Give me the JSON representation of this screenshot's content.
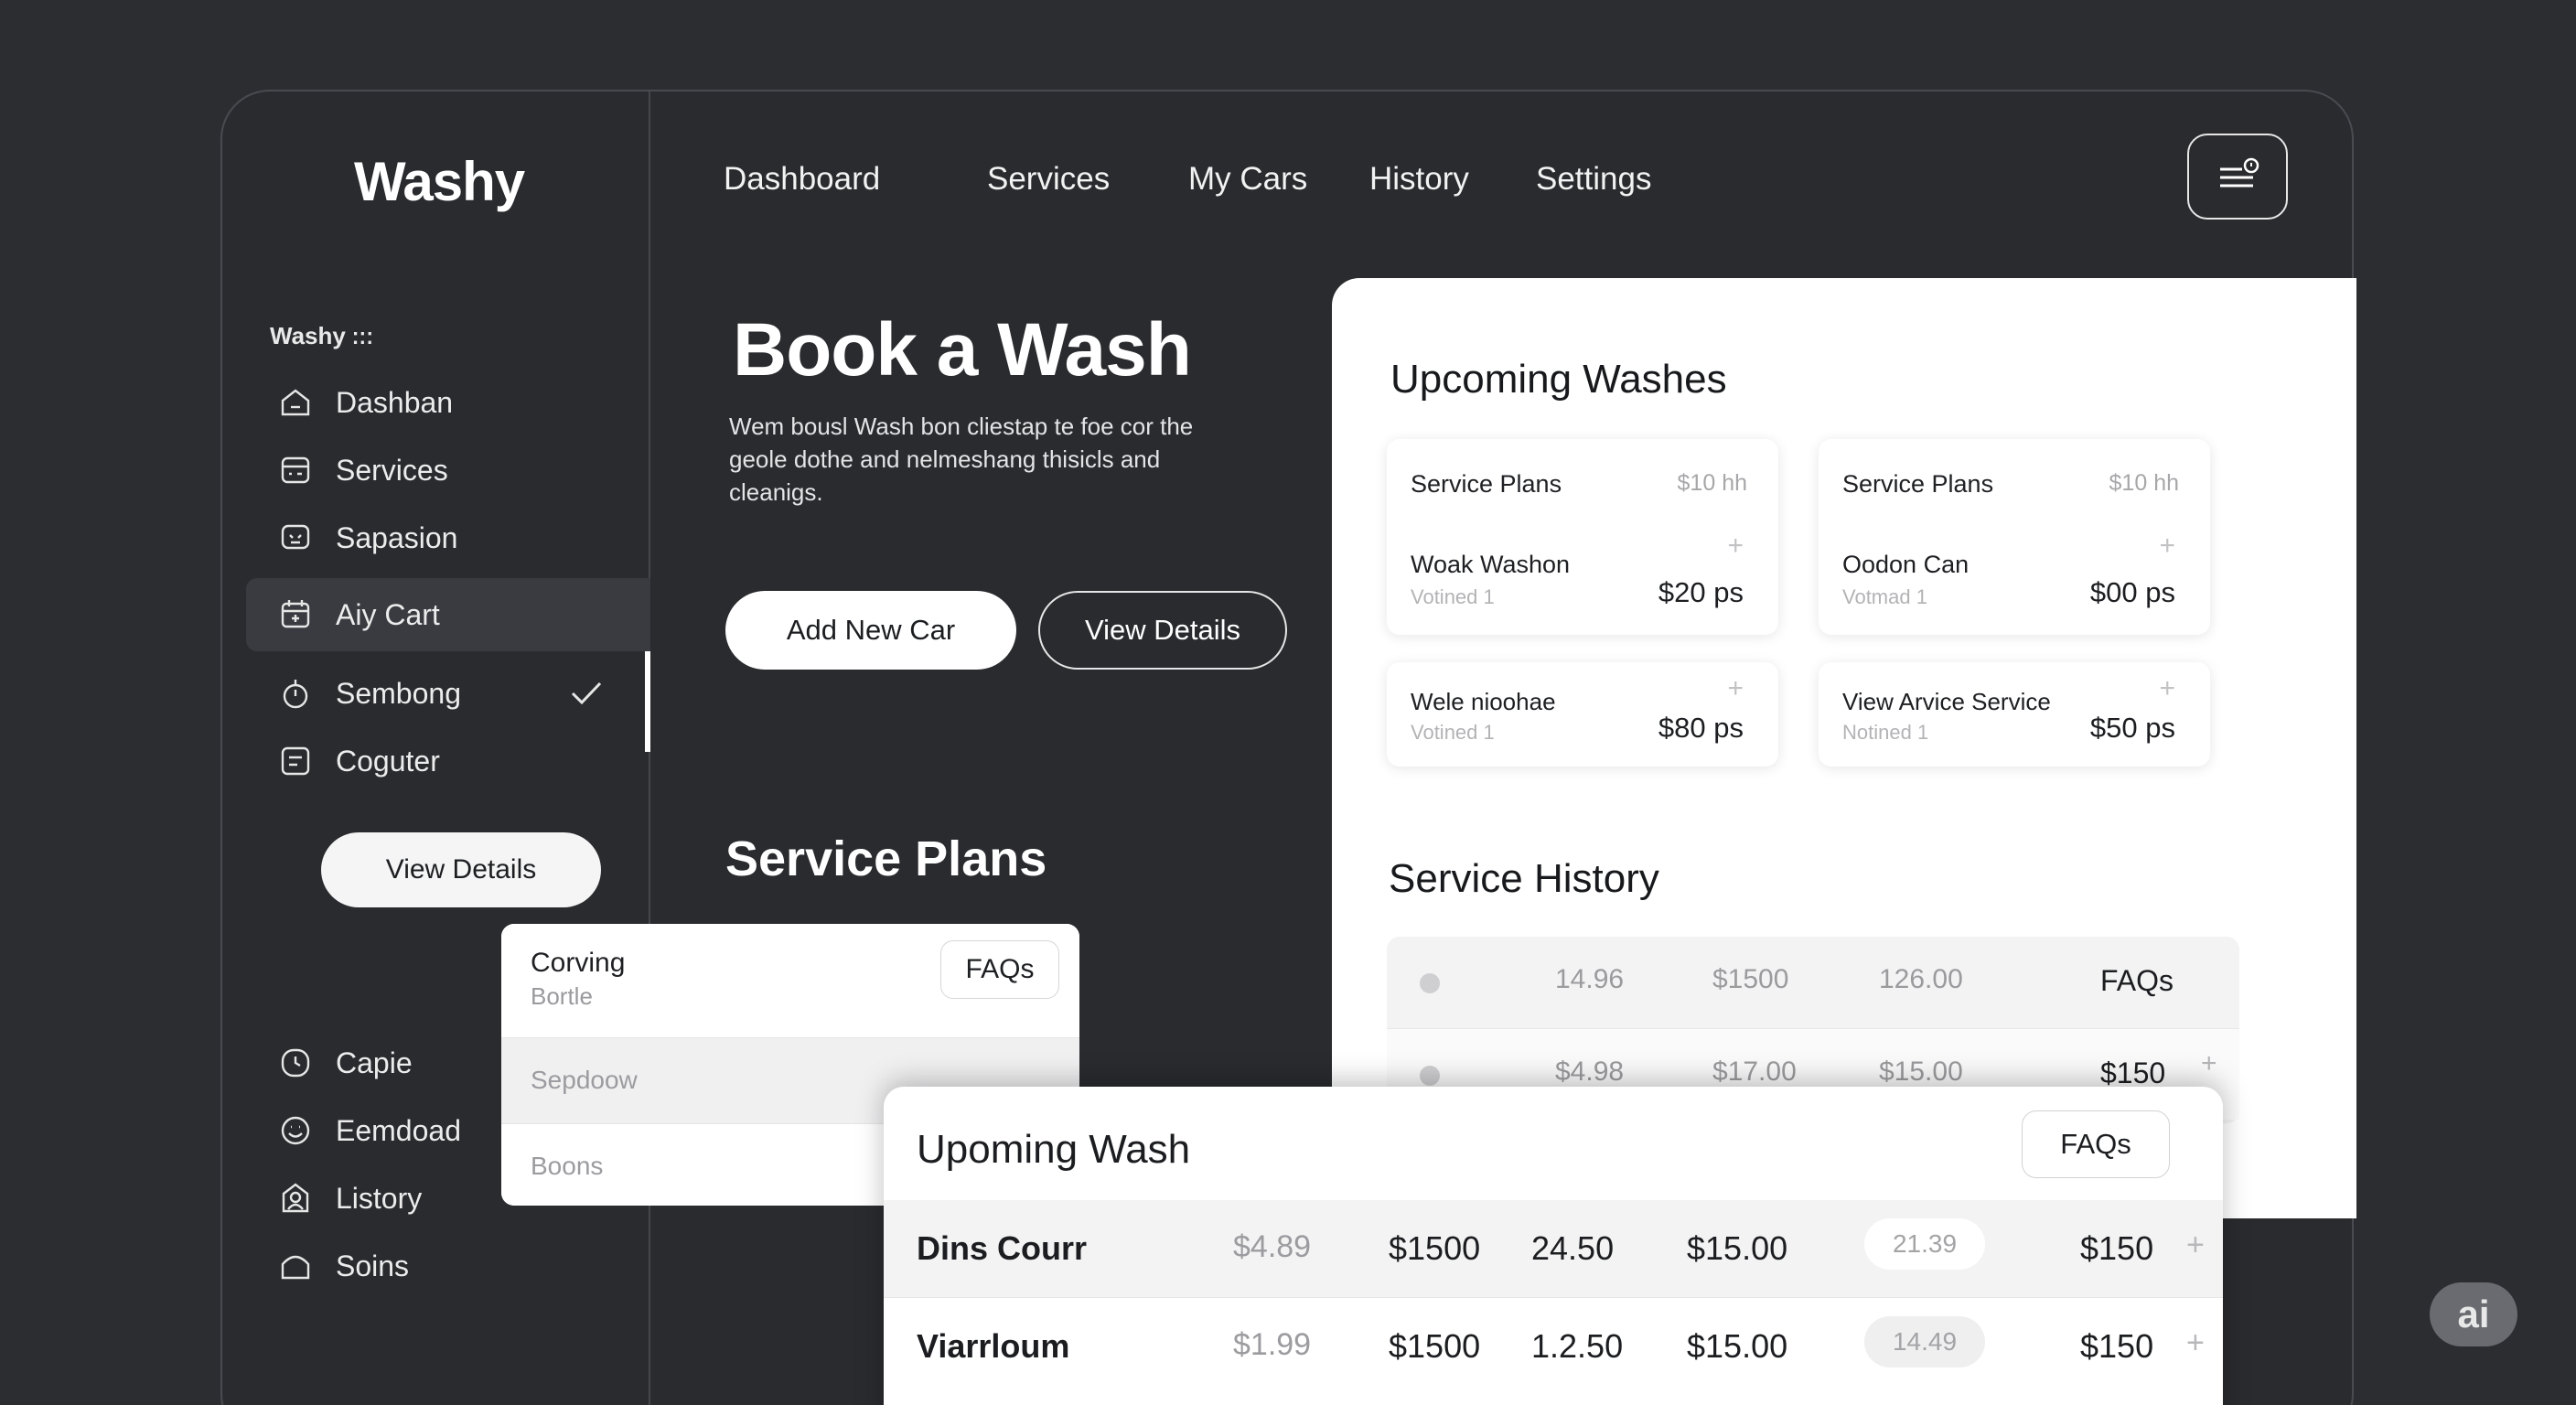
{
  "app": {
    "logo": "Washy"
  },
  "sidebar": {
    "section_label": "Washy",
    "items": [
      {
        "label": "Dashban",
        "icon": "home-icon"
      },
      {
        "label": "Services",
        "icon": "calendar-icon"
      },
      {
        "label": "Sapasion",
        "icon": "chat-icon"
      },
      {
        "label": "Aiy Cart",
        "icon": "calendar-plus-icon"
      },
      {
        "label": "Sembong",
        "icon": "timer-icon"
      },
      {
        "label": "Coguter",
        "icon": "list-icon"
      },
      {
        "label": "Capie",
        "icon": "clock-icon"
      },
      {
        "label": "Eemdoad",
        "icon": "smile-icon"
      },
      {
        "label": "Listory",
        "icon": "user-icon"
      },
      {
        "label": "Soins",
        "icon": "home-outline-icon"
      }
    ],
    "view_details": "View Details"
  },
  "nav": {
    "dashboard": "Dashboard",
    "services": "Services",
    "my_cars": "My Cars",
    "history": "History",
    "settings": "Settings"
  },
  "hero": {
    "title": "Book a Wash",
    "text": "Wem bousl Wash bon cliestap te foe cor the geole dothe and nelmeshang thisicls and cleanigs.",
    "add_button": "Add New Car",
    "view_button": "View Details"
  },
  "plans": {
    "title": "Service Plans",
    "faq": "FAQs",
    "rows": [
      {
        "title": "Corving",
        "sub": "Bortle"
      },
      {
        "title": "Sepdoow"
      },
      {
        "title": "Boons"
      }
    ]
  },
  "upcoming": {
    "title": "Upcoming Washes",
    "cards": [
      {
        "head": "Service Plans",
        "rate": "$10 hh",
        "name": "Woak Washon",
        "sub": "Votined 1",
        "price": "$20 ps"
      },
      {
        "head": "Service Plans",
        "rate": "$10 hh",
        "name": "Oodon Can",
        "sub": "Votmad 1",
        "price": "$00 ps"
      },
      {
        "name": "Wele nioohae",
        "sub": "Votined 1",
        "price": "$80 ps"
      },
      {
        "name": "View Arvice Service",
        "sub": "Notined 1",
        "price": "$50 ps"
      }
    ]
  },
  "history": {
    "title": "Service History",
    "rows": [
      {
        "a": "14.96",
        "b": "$1500",
        "c": "126.00",
        "d": "FAQs"
      },
      {
        "a": "$4.98",
        "b": "$17.00",
        "c": "$15.00",
        "d": "$150"
      }
    ]
  },
  "upwash": {
    "title": "Upoming Wash",
    "faq": "FAQs",
    "rows": [
      {
        "name": "Dins Courr",
        "a": "$4.89",
        "b": "$1500",
        "c": "24.50",
        "d": "$15.00",
        "e": "21.39",
        "f": "$150"
      },
      {
        "name": "Viarrloum",
        "a": "$1.99",
        "b": "$1500",
        "c": "1.2.50",
        "d": "$15.00",
        "e": "14.49",
        "f": "$150"
      }
    ]
  },
  "badge": "ai"
}
